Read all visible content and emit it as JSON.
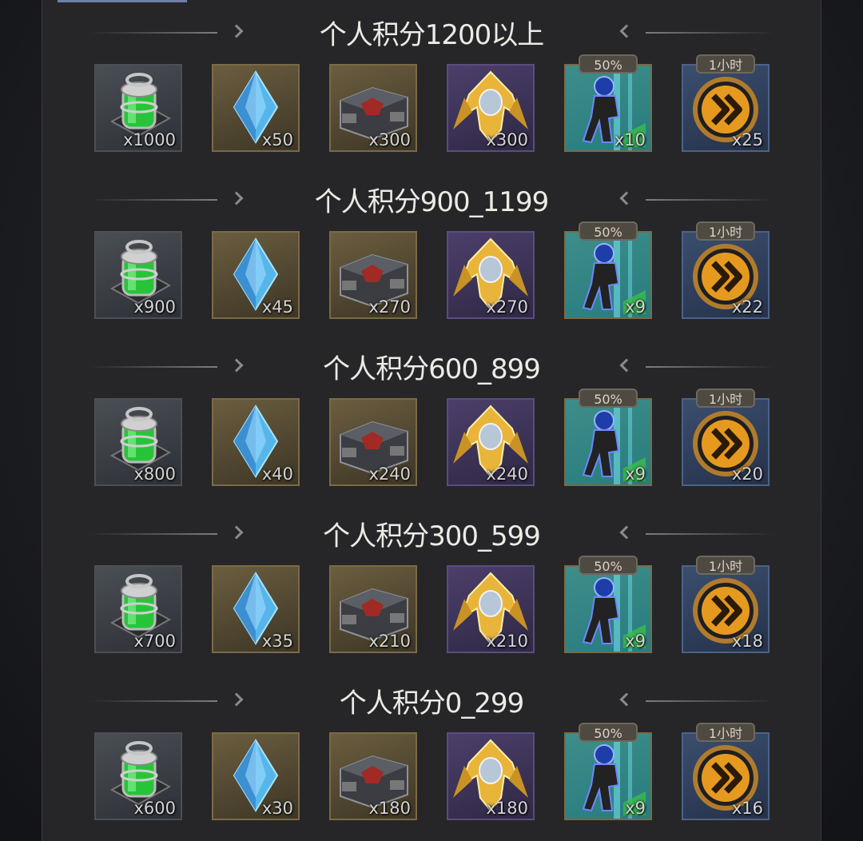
{
  "tiers": [
    {
      "title": "个人积分1200以上",
      "counts": [
        "x1000",
        "x50",
        "x300",
        "x300",
        "x10",
        "x25"
      ]
    },
    {
      "title": "个人积分900_1199",
      "counts": [
        "x900",
        "x45",
        "x270",
        "x270",
        "x9",
        "x22"
      ]
    },
    {
      "title": "个人积分600_899",
      "counts": [
        "x800",
        "x40",
        "x240",
        "x240",
        "x9",
        "x20"
      ]
    },
    {
      "title": "个人积分300_599",
      "counts": [
        "x700",
        "x35",
        "x210",
        "x210",
        "x9",
        "x18"
      ]
    },
    {
      "title": "个人积分0_299",
      "counts": [
        "x600",
        "x30",
        "x180",
        "x180",
        "x9",
        "x16"
      ]
    }
  ],
  "items": [
    {
      "icon": "green-canister-icon",
      "frame": "grey"
    },
    {
      "icon": "blue-crystal-icon",
      "frame": "gold"
    },
    {
      "icon": "armor-chest-icon",
      "frame": "gold"
    },
    {
      "icon": "gold-emblem-icon",
      "frame": "purple"
    },
    {
      "icon": "soldier-speedup-icon",
      "frame": "gold",
      "tag": "50%"
    },
    {
      "icon": "speedup-chevron-icon",
      "frame": "blue",
      "tag": "1小时"
    }
  ]
}
